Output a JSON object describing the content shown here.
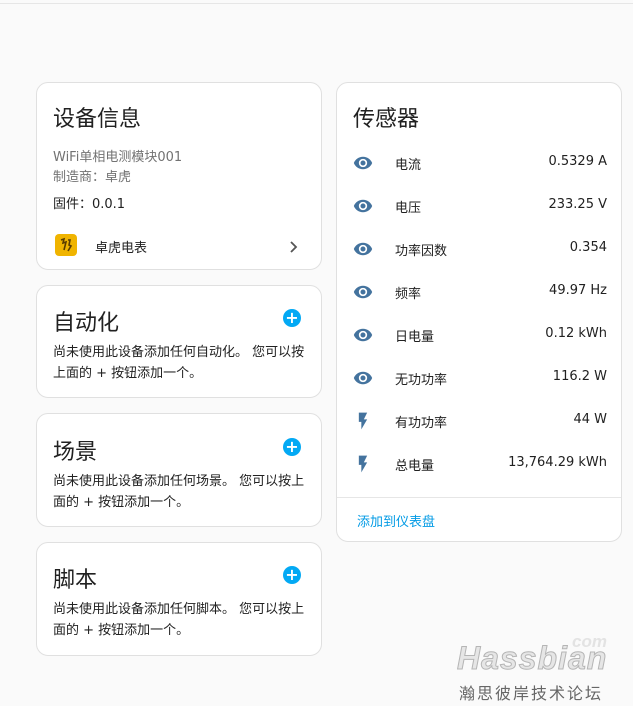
{
  "device_info": {
    "title": "设备信息",
    "model": "WiFi单相电测模块001",
    "manufacturer": "制造商：卓虎",
    "firmware": "固件：0.0.1",
    "integration_label": "卓虎电表"
  },
  "automation": {
    "title": "自动化",
    "line1": "尚未使用此设备添加任何自动化。 您可以按",
    "line2": "上面的 + 按钮添加一个。"
  },
  "scene": {
    "title": "场景",
    "line1": "尚未使用此设备添加任何场景。 您可以按上",
    "line2": "面的 + 按钮添加一个。"
  },
  "script": {
    "title": "脚本",
    "line1": "尚未使用此设备添加任何脚本。 您可以按上",
    "line2": "面的 + 按钮添加一个。"
  },
  "sensors": {
    "title": "传感器",
    "items": [
      {
        "icon": "eye-icon",
        "name": "电流",
        "value": "0.5329 A"
      },
      {
        "icon": "eye-icon",
        "name": "电压",
        "value": "233.25 V"
      },
      {
        "icon": "eye-icon",
        "name": "功率因数",
        "value": "0.354"
      },
      {
        "icon": "eye-icon",
        "name": "频率",
        "value": "49.97 Hz"
      },
      {
        "icon": "eye-icon",
        "name": "日电量",
        "value": "0.12 kWh"
      },
      {
        "icon": "eye-icon",
        "name": "无功功率",
        "value": "116.2 W"
      },
      {
        "icon": "flash-icon",
        "name": "有功功率",
        "value": "44 W"
      },
      {
        "icon": "flash-icon",
        "name": "总电量",
        "value": "13,764.29 kWh"
      }
    ],
    "add_to_dashboard": "添加到仪表盘"
  },
  "watermark": {
    "brand": "Hassbian",
    "tld": "com",
    "slogan": "瀚思彼岸技术论坛"
  },
  "colors": {
    "accent": "#03a9f4",
    "icon": "#44739e",
    "link": "#039be5",
    "badge": "#f0b400"
  }
}
